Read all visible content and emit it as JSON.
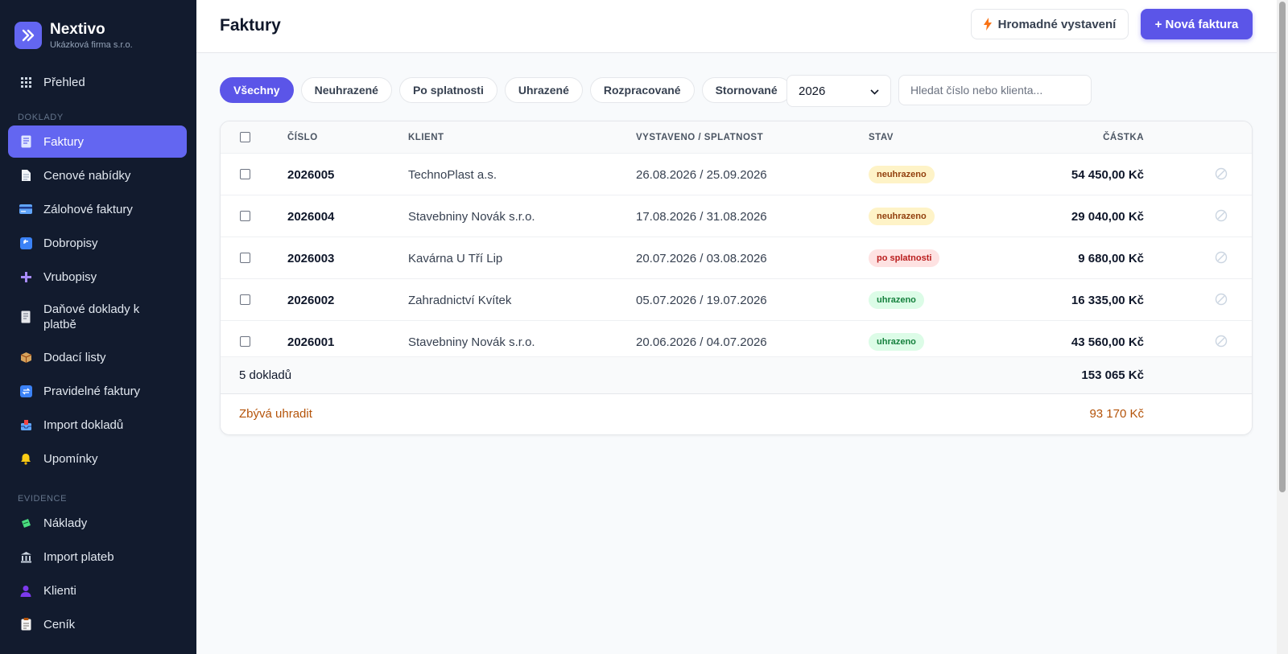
{
  "brand": {
    "name": "Nextivo",
    "subtitle": "Ukázková firma s.r.o."
  },
  "sidebar": {
    "top_item": {
      "label": "Přehled",
      "icon": "grid-icon"
    },
    "section_doklady": "DOKLADY",
    "doklady_items": [
      {
        "label": "Faktury",
        "icon": "invoice-icon",
        "active": true
      },
      {
        "label": "Cenové nabídky",
        "icon": "document-icon"
      },
      {
        "label": "Zálohové faktury",
        "icon": "card-icon"
      },
      {
        "label": "Dobropisy",
        "icon": "return-icon"
      },
      {
        "label": "Vrubopisy",
        "icon": "plus-icon"
      },
      {
        "label": "Daňové doklady k platbě",
        "icon": "receipt-icon"
      },
      {
        "label": "Dodací listy",
        "icon": "package-icon"
      },
      {
        "label": "Pravidelné faktury",
        "icon": "repeat-icon"
      },
      {
        "label": "Import dokladů",
        "icon": "inbox-icon"
      },
      {
        "label": "Upomínky",
        "icon": "bell-icon"
      }
    ],
    "section_evidence": "EVIDENCE",
    "evidence_items": [
      {
        "label": "Náklady",
        "icon": "money-icon"
      },
      {
        "label": "Import plateb",
        "icon": "bank-icon"
      },
      {
        "label": "Klienti",
        "icon": "user-icon"
      },
      {
        "label": "Ceník",
        "icon": "clipboard-icon"
      }
    ]
  },
  "header": {
    "title": "Faktury",
    "bulk_button": "Hromadné vystavení",
    "new_button": "+ Nová faktura"
  },
  "filters": {
    "chips": [
      "Všechny",
      "Neuhrazené",
      "Po splatnosti",
      "Uhrazené",
      "Rozpracované",
      "Stornované"
    ],
    "active_index": 0,
    "year": "2026",
    "search_placeholder": "Hledat číslo nebo klienta..."
  },
  "table": {
    "columns": {
      "number": "ČÍSLO",
      "client": "KLIENT",
      "dates": "VYSTAVENO / SPLATNOST",
      "status": "STAV",
      "amount": "ČÁSTKA"
    },
    "rows": [
      {
        "number": "2026005",
        "client": "TechnoPlast a.s.",
        "dates": "26.08.2026 / 25.09.2026",
        "status": "neuhrazeno",
        "status_type": "unpaid",
        "amount": "54 450,00 Kč"
      },
      {
        "number": "2026004",
        "client": "Stavebniny Novák s.r.o.",
        "dates": "17.08.2026 / 31.08.2026",
        "status": "neuhrazeno",
        "status_type": "unpaid",
        "amount": "29 040,00 Kč"
      },
      {
        "number": "2026003",
        "client": "Kavárna U Tří Lip",
        "dates": "20.07.2026 / 03.08.2026",
        "status": "po splatnosti",
        "status_type": "overdue",
        "amount": "9 680,00 Kč"
      },
      {
        "number": "2026002",
        "client": "Zahradnictví Kvítek",
        "dates": "05.07.2026 / 19.07.2026",
        "status": "uhrazeno",
        "status_type": "paid",
        "amount": "16 335,00 Kč"
      },
      {
        "number": "2026001",
        "client": "Stavebniny Novák s.r.o.",
        "dates": "20.06.2026 / 04.07.2026",
        "status": "uhrazeno",
        "status_type": "paid",
        "amount": "43 560,00 Kč"
      }
    ],
    "total_label": "5 dokladů",
    "total_value": "153 065 Kč",
    "remaining_label": "Zbývá uhradit",
    "remaining_value": "93 170 Kč"
  },
  "colors": {
    "accent": "#5b55e8",
    "sidebar_bg": "#121b2e",
    "remaining": "#b45309"
  }
}
